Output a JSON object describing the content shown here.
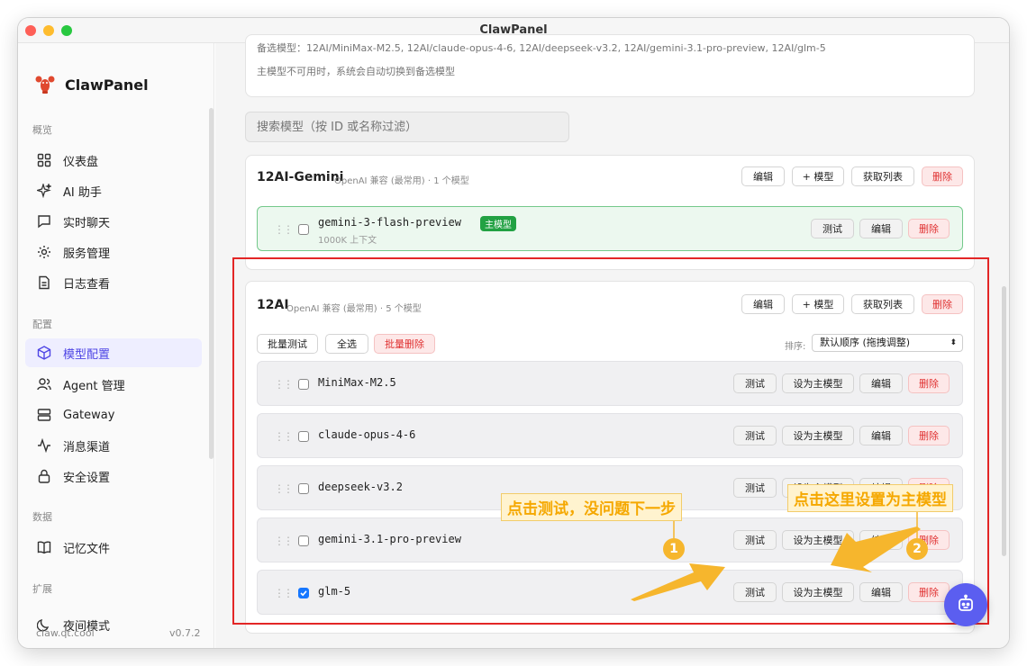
{
  "window": {
    "title": "ClawPanel"
  },
  "sidebar": {
    "brand": "ClawPanel",
    "sections": {
      "overview": "概览",
      "config": "配置",
      "data": "数据",
      "extend": "扩展"
    },
    "items": [
      {
        "label": "仪表盘",
        "icon": "dashboard-icon"
      },
      {
        "label": "AI 助手",
        "icon": "sparkle-icon"
      },
      {
        "label": "实时聊天",
        "icon": "chat-icon"
      },
      {
        "label": "服务管理",
        "icon": "gear-icon"
      },
      {
        "label": "日志查看",
        "icon": "document-icon"
      },
      {
        "label": "模型配置",
        "icon": "cube-icon"
      },
      {
        "label": "Agent 管理",
        "icon": "users-icon"
      },
      {
        "label": "Gateway",
        "icon": "server-icon"
      },
      {
        "label": "消息渠道",
        "icon": "pulse-icon"
      },
      {
        "label": "安全设置",
        "icon": "lock-icon"
      },
      {
        "label": "记忆文件",
        "icon": "book-icon"
      },
      {
        "label": "夜间模式",
        "icon": "moon-icon"
      }
    ],
    "footer_site": "claw.qt.cool",
    "footer_version": "v0.7.2"
  },
  "top_card": {
    "fallback_line": "备选模型：12AI/MiniMax-M2.5, 12AI/claude-opus-4-6, 12AI/deepseek-v3.2, 12AI/gemini-3.1-pro-preview, 12AI/glm-5",
    "hint": "主模型不可用时，系统会自动切换到备选模型"
  },
  "search": {
    "placeholder": "搜索模型（按 ID 或名称过滤）"
  },
  "providers": [
    {
      "name": "12AI-Gemini",
      "meta": "OpenAI 兼容 (最常用) · 1 个模型",
      "buttons": {
        "edit": "编辑",
        "add": "+ 模型",
        "fetch": "获取列表",
        "delete": "删除"
      },
      "models": [
        {
          "name": "gemini-3-flash-preview",
          "badge": "主模型",
          "sub": "1000K 上下文",
          "test": "测试",
          "edit": "编辑",
          "delete": "删除"
        }
      ]
    },
    {
      "name": "12AI",
      "meta": "OpenAI 兼容 (最常用) · 5 个模型",
      "buttons": {
        "edit": "编辑",
        "add": "+ 模型",
        "fetch": "获取列表",
        "delete": "删除"
      },
      "bulk": {
        "test": "批量测试",
        "select_all": "全选",
        "delete": "批量删除"
      },
      "sort": {
        "label": "排序:",
        "value": "默认顺序 (拖拽调整)"
      },
      "models": [
        {
          "name": "MiniMax-M2.5",
          "checked": false,
          "test": "测试",
          "set_primary": "设为主模型",
          "edit": "编辑",
          "delete": "删除"
        },
        {
          "name": "claude-opus-4-6",
          "checked": false,
          "test": "测试",
          "set_primary": "设为主模型",
          "edit": "编辑",
          "delete": "删除"
        },
        {
          "name": "deepseek-v3.2",
          "checked": false,
          "test": "测试",
          "set_primary": "设为主模型",
          "edit": "编辑",
          "delete": "删除"
        },
        {
          "name": "gemini-3.1-pro-preview",
          "checked": false,
          "test": "测试",
          "set_primary": "设为主模型",
          "edit": "编辑",
          "delete": "删除"
        },
        {
          "name": "glm-5",
          "checked": true,
          "test": "测试",
          "set_primary": "设为主模型",
          "edit": "编辑",
          "delete": "删除"
        }
      ]
    }
  ],
  "annotations": {
    "step1_text": "点击测试，没问题下一步",
    "step2_text": "点击这里设置为主模型",
    "step1_num": "1",
    "step2_num": "2"
  },
  "colors": {
    "accent": "#5b5ef0",
    "danger": "#e03131",
    "primary_badge": "#22a143",
    "annotation": "#f6b62d",
    "highlight_box": "#e32626"
  }
}
